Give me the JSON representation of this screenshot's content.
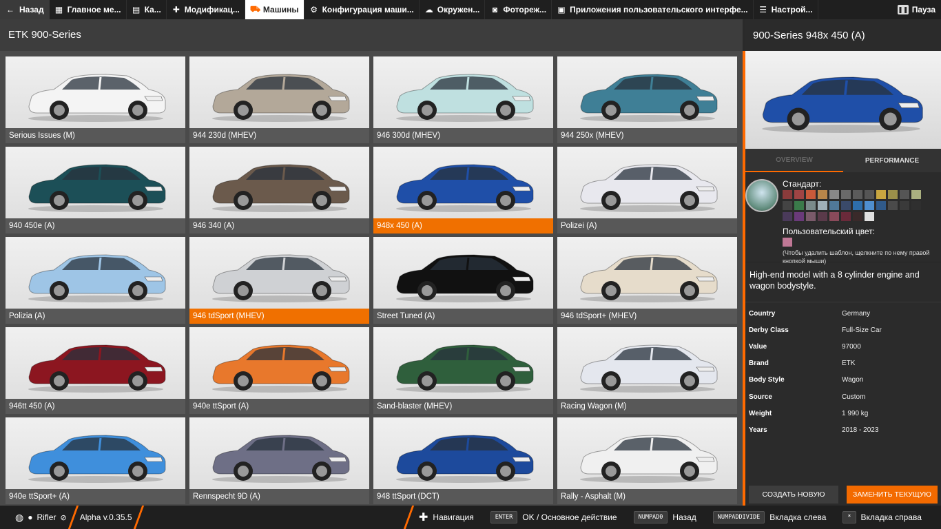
{
  "topbar": {
    "back_label": "Назад",
    "tabs": [
      {
        "label": "Главное ме...",
        "icon": "grid-icon"
      },
      {
        "label": "Ка...",
        "icon": "map-icon"
      },
      {
        "label": "Модификац...",
        "icon": "puzzle-icon"
      },
      {
        "label": "Машины",
        "icon": "car-icon",
        "active": true
      },
      {
        "label": "Конфигурация маши...",
        "icon": "engine-icon"
      },
      {
        "label": "Окружен...",
        "icon": "weather-icon"
      },
      {
        "label": "Фотореж...",
        "icon": "camera-icon"
      },
      {
        "label": "Приложения пользовательского интерфе...",
        "icon": "apps-icon"
      },
      {
        "label": "Настрой...",
        "icon": "sliders-icon"
      }
    ],
    "pause_label": "Пауза"
  },
  "left": {
    "header": "ETK 900-Series",
    "cards": [
      {
        "label": "Serious Issues (M)",
        "color": "#f4f4f4"
      },
      {
        "label": "944 230d (MHEV)",
        "color": "#b3a899"
      },
      {
        "label": "946 300d (MHEV)",
        "color": "#bfe0e0"
      },
      {
        "label": "944 250x (MHEV)",
        "color": "#3f7f96"
      },
      {
        "label": "940 450e (A)",
        "color": "#1c4f57"
      },
      {
        "label": "946 340 (A)",
        "color": "#6b5a4c"
      },
      {
        "label": "948x 450 (A)",
        "color": "#1f4fa8",
        "selected": true
      },
      {
        "label": "Polizei (A)",
        "color": "#e8e8ee"
      },
      {
        "label": "Polizia (A)",
        "color": "#9ec5e6"
      },
      {
        "label": "946 tdSport (MHEV)",
        "color": "#cfd1d4",
        "selected": true
      },
      {
        "label": "Street Tuned (A)",
        "color": "#111111"
      },
      {
        "label": "946 tdSport+ (MHEV)",
        "color": "#e6dccb"
      },
      {
        "label": "946tt 450 (A)",
        "color": "#8c1620"
      },
      {
        "label": "940e ttSport (A)",
        "color": "#e8782c"
      },
      {
        "label": "Sand-blaster (MHEV)",
        "color": "#2f5f3c"
      },
      {
        "label": "Racing Wagon (M)",
        "color": "#e4e7ee"
      },
      {
        "label": "940e ttSport+ (A)",
        "color": "#3f8fdc"
      },
      {
        "label": "Rennspecht 9D (A)",
        "color": "#6e6f86"
      },
      {
        "label": "948 ttSport (DCT)",
        "color": "#1d4a9c"
      },
      {
        "label": "Rally - Asphalt (M)",
        "color": "#f0f0f0"
      }
    ]
  },
  "right": {
    "title": "900-Series 948x 450 (A)",
    "preview_color": "#1f4fa8",
    "tab_overview": "OVERVIEW",
    "tab_performance": "PERFORMANCE",
    "palette_title": "Стандарт:",
    "swatches": [
      "#8a3b3b",
      "#a04444",
      "#c85a3a",
      "#b8864a",
      "#888888",
      "#6a6a6a",
      "#5b5b5b",
      "#555555",
      "#c8a640",
      "#9a8f4a",
      "#555555",
      "#aab080",
      "#444444",
      "#3a7a4a",
      "#7a8a8a",
      "#a0b0b8",
      "#507898",
      "#3a4a6a",
      "#2e6eaa",
      "#4f8fcf",
      "#305a8a",
      "#4a4a4a",
      "#3a3a3a",
      "#2f2f2f",
      "#4a3a5a",
      "#6a3a7a",
      "#7a5a6a",
      "#5a3a4a",
      "#8a4a5a",
      "#6a2a3a",
      "#3a2a2a",
      "#e0e0e0"
    ],
    "custom_title": "Пользовательский цвет:",
    "hint": "(Чтобы удалить шаблон, щелкните по нему правой кнопкой мыши)",
    "description": "High-end model with a 8 cylinder engine and wagon bodystyle.",
    "specs": [
      {
        "key": "Country",
        "value": "Germany"
      },
      {
        "key": "Derby Class",
        "value": "Full-Size Car"
      },
      {
        "key": "Value",
        "value": "97000"
      },
      {
        "key": "Brand",
        "value": "ETK"
      },
      {
        "key": "Body Style",
        "value": "Wagon"
      },
      {
        "key": "Source",
        "value": "Custom"
      },
      {
        "key": "Weight",
        "value": "1 990 kg"
      },
      {
        "key": "Years",
        "value": "2018 - 2023"
      }
    ],
    "btn_new": "СОЗДАТЬ НОВУЮ",
    "btn_replace": "ЗАМЕНИТЬ ТЕКУЩУЮ"
  },
  "bottom": {
    "user": "Rifler",
    "version": "Alpha v.0.35.5",
    "nav_label": "Навигация",
    "enter_key": "ENTER",
    "enter_label": "OK / Основное действие",
    "numpad0_key": "NUMPAD0",
    "numpad0_label": "Назад",
    "numdiv_key": "NUMPADDIVIDE",
    "numdiv_label": "Вкладка слева",
    "star_key": "*",
    "star_label": "Вкладка справа"
  }
}
